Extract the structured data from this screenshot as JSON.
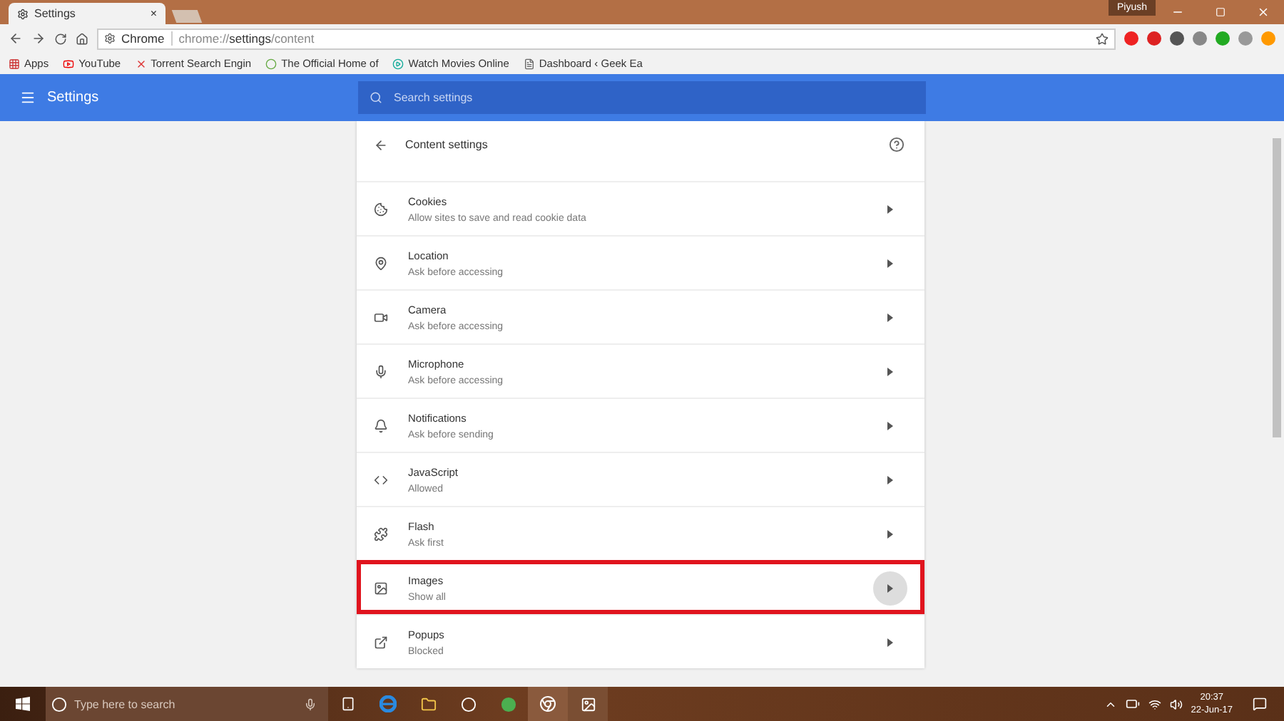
{
  "window": {
    "tab": {
      "title": "Settings",
      "close": "×"
    },
    "profile": "Piyush"
  },
  "toolbar": {
    "site_label": "Chrome",
    "url": "chrome://**settings**/content"
  },
  "bookmarks": [
    {
      "label": "Apps"
    },
    {
      "label": "YouTube"
    },
    {
      "label": "Torrent Search Engin"
    },
    {
      "label": "The Official Home of"
    },
    {
      "label": "Watch Movies Online"
    },
    {
      "label": "Dashboard ‹ Geek Ea"
    }
  ],
  "header": {
    "title": "Settings",
    "search": {
      "placeholder": "Search settings"
    }
  },
  "page": {
    "title": "Content settings"
  },
  "settings": [
    {
      "label": "Cookies",
      "description": "Allow sites to save and read cookie data",
      "highlighted": false
    },
    {
      "label": "Location",
      "description": "Ask before accessing",
      "highlighted": false
    },
    {
      "label": "Camera",
      "description": "Ask before accessing",
      "highlighted": false
    },
    {
      "label": "Microphone",
      "description": "Ask before accessing",
      "highlighted": false
    },
    {
      "label": "Notifications",
      "description": "Ask before sending",
      "highlighted": false
    },
    {
      "label": "JavaScript",
      "description": "Allowed",
      "highlighted": false
    },
    {
      "label": "Flash",
      "description": "Ask first",
      "highlighted": false
    },
    {
      "label": "Images",
      "description": "Show all",
      "highlighted": true
    },
    {
      "label": "Popups",
      "description": "Blocked",
      "highlighted": false
    }
  ],
  "taskbar": {
    "search": {
      "placeholder": "Type here to search"
    },
    "time": "20:37",
    "date": "22-Jun-17"
  }
}
